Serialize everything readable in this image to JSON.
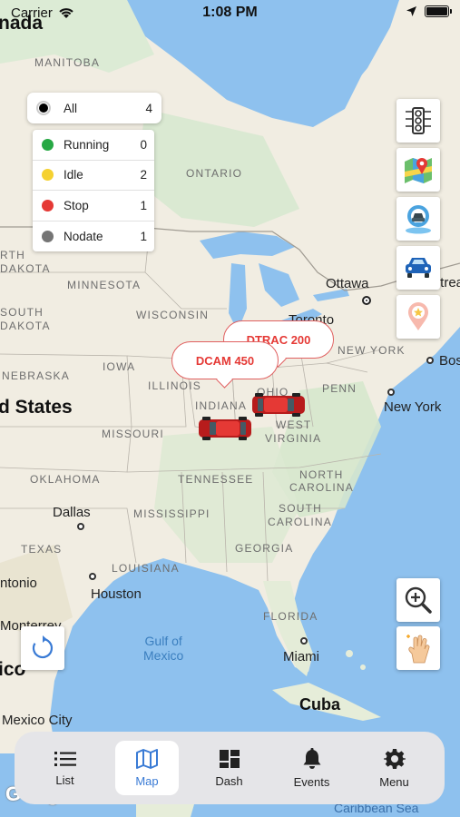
{
  "status_bar": {
    "carrier": "Carrier",
    "time": "1:08 PM",
    "battery_pct": 100
  },
  "map": {
    "labels": {
      "canada": "nada",
      "manitoba": "MANITOBA",
      "ontario": "ONTARIO",
      "north_dakota_1": "RTH",
      "north_dakota_2": "DAKOTA",
      "minnesota": "MINNESOTA",
      "south_dakota_1": "SOUTH",
      "south_dakota_2": "DAKOTA",
      "wisconsin": "WISCONSIN",
      "nebraska": "NEBRASKA",
      "iowa": "IOWA",
      "illinois": "ILLINOIS",
      "indiana": "INDIANA",
      "ohio": "OHIO",
      "penn": "PENN",
      "new_york_state": "NEW YORK",
      "west_virginia_1": "WEST",
      "west_virginia_2": "VIRGINIA",
      "missouri": "MISSOURI",
      "united_states": "d States",
      "tennessee": "TENNESSEE",
      "oklahoma": "OKLAHOMA",
      "north_carolina_1": "NORTH",
      "north_carolina_2": "CAROLINA",
      "south_carolina_1": "SOUTH",
      "south_carolina_2": "CAROLINA",
      "mississippi": "MISSISSIPPI",
      "texas": "TEXAS",
      "louisiana": "LOUISIANA",
      "georgia": "GEORGIA",
      "florida": "FLORIDA",
      "dallas": "Dallas",
      "houston": "Houston",
      "san_antonio": "ntonio",
      "monterrey": "Monterrey",
      "mexico_edge": "ico",
      "mexico_city": "Mexico City",
      "ottawa": "Ottawa",
      "montreal": "Montreal",
      "toronto": "Toronto",
      "boston": "Bos",
      "new_york_city": "New York",
      "miami": "Miami",
      "cuba": "Cuba",
      "gulf_1": "Gulf of",
      "gulf_2": "Mexico",
      "caribbean": "Caribbean Sea",
      "google": "Google"
    }
  },
  "filters": {
    "all": {
      "label": "All",
      "count": "4",
      "color": "#000000"
    },
    "items": [
      {
        "label": "Running",
        "count": "0",
        "color": "#27a844"
      },
      {
        "label": "Idle",
        "count": "2",
        "color": "#f5d131"
      },
      {
        "label": "Stop",
        "count": "1",
        "color": "#e53935"
      },
      {
        "label": "Nodate",
        "count": "1",
        "color": "#757575"
      }
    ]
  },
  "tools": [
    {
      "icon": "traffic-light-icon"
    },
    {
      "icon": "map-type-icon"
    },
    {
      "icon": "focus-vehicle-icon"
    },
    {
      "icon": "vehicle-car-icon"
    },
    {
      "icon": "location-star-pin-icon"
    }
  ],
  "map_controls": {
    "zoom_icon": "zoom-in-icon",
    "gesture_icon": "hand-gesture-icon",
    "refresh_icon": "refresh-icon"
  },
  "vehicles": [
    {
      "name": "DTRAC 200",
      "color": "#c62828"
    },
    {
      "name": "DCAM 450",
      "color": "#c62828"
    }
  ],
  "tabbar": {
    "tabs": [
      {
        "label": "List",
        "icon": "list-icon"
      },
      {
        "label": "Map",
        "icon": "map-icon",
        "active": true
      },
      {
        "label": "Dash",
        "icon": "dashboard-icon"
      },
      {
        "label": "Events",
        "icon": "bell-icon"
      },
      {
        "label": "Menu",
        "icon": "gear-icon"
      }
    ]
  },
  "colors": {
    "accent": "#3a7bd5",
    "water": "#8ec1ee",
    "land": "#f1ede2"
  }
}
